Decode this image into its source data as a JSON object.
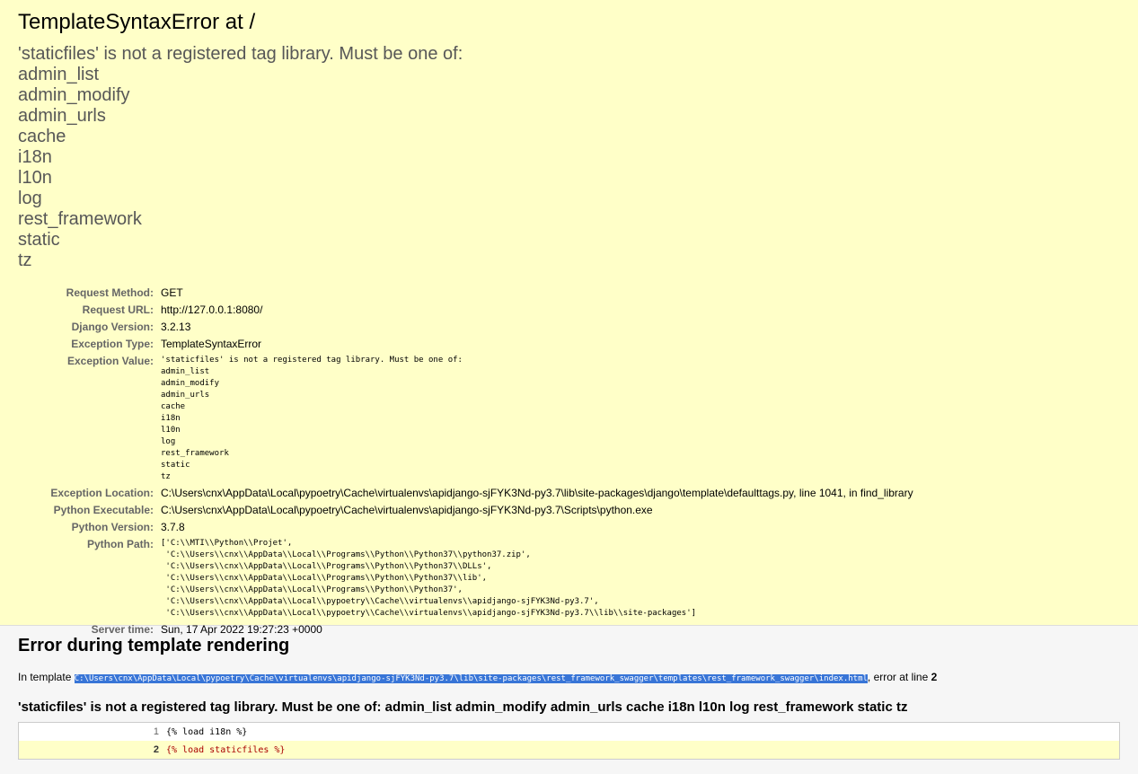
{
  "summary": {
    "title": "TemplateSyntaxError at /",
    "exception_lines": [
      "'staticfiles' is not a registered tag library. Must be one of:",
      "admin_list",
      "admin_modify",
      "admin_urls",
      "cache",
      "i18n",
      "l10n",
      "log",
      "rest_framework",
      "static",
      "tz"
    ],
    "meta": {
      "request_method_label": "Request Method:",
      "request_method": "GET",
      "request_url_label": "Request URL:",
      "request_url": "http://127.0.0.1:8080/",
      "django_version_label": "Django Version:",
      "django_version": "3.2.13",
      "exception_type_label": "Exception Type:",
      "exception_type": "TemplateSyntaxError",
      "exception_value_label": "Exception Value:",
      "exception_value": "'staticfiles' is not a registered tag library. Must be one of:\nadmin_list\nadmin_modify\nadmin_urls\ncache\ni18n\nl10n\nlog\nrest_framework\nstatic\ntz",
      "exception_location_label": "Exception Location:",
      "exception_location": "C:\\Users\\cnx\\AppData\\Local\\pypoetry\\Cache\\virtualenvs\\apidjango-sjFYK3Nd-py3.7\\lib\\site-packages\\django\\template\\defaulttags.py, line 1041, in find_library",
      "python_executable_label": "Python Executable:",
      "python_executable": "C:\\Users\\cnx\\AppData\\Local\\pypoetry\\Cache\\virtualenvs\\apidjango-sjFYK3Nd-py3.7\\Scripts\\python.exe",
      "python_version_label": "Python Version:",
      "python_version": "3.7.8",
      "python_path_label": "Python Path:",
      "python_path": "['C:\\\\MTI\\\\Python\\\\Projet',\n 'C:\\\\Users\\\\cnx\\\\AppData\\\\Local\\\\Programs\\\\Python\\\\Python37\\\\python37.zip',\n 'C:\\\\Users\\\\cnx\\\\AppData\\\\Local\\\\Programs\\\\Python\\\\Python37\\\\DLLs',\n 'C:\\\\Users\\\\cnx\\\\AppData\\\\Local\\\\Programs\\\\Python\\\\Python37\\\\lib',\n 'C:\\\\Users\\\\cnx\\\\AppData\\\\Local\\\\Programs\\\\Python\\\\Python37',\n 'C:\\\\Users\\\\cnx\\\\AppData\\\\Local\\\\pypoetry\\\\Cache\\\\virtualenvs\\\\apidjango-sjFYK3Nd-py3.7',\n 'C:\\\\Users\\\\cnx\\\\AppData\\\\Local\\\\pypoetry\\\\Cache\\\\virtualenvs\\\\apidjango-sjFYK3Nd-py3.7\\\\lib\\\\site-packages']",
      "server_time_label": "Server time:",
      "server_time": "Sun, 17 Apr 2022 19:27:23 +0000"
    }
  },
  "template": {
    "heading": "Error during template rendering",
    "in_template_prefix": "In template ",
    "template_path": "C:\\Users\\cnx\\AppData\\Local\\pypoetry\\Cache\\virtualenvs\\apidjango-sjFYK3Nd-py3.7\\lib\\site-packages\\rest_framework_swagger\\templates\\rest_framework_swagger\\index.html",
    "error_at_line_text": ", error at line ",
    "error_line": "2",
    "error_message": "'staticfiles' is not a registered tag library. Must be one of: admin_list admin_modify admin_urls cache i18n l10n log rest_framework static tz",
    "source_lines": [
      {
        "num": "1",
        "code": "{% load i18n %}"
      },
      {
        "num": "2",
        "code": "{% load staticfiles %}"
      }
    ]
  },
  "colors": {
    "summary_bg": "#ffffc8",
    "template_bg": "#f6f6f6",
    "selection_bg": "#3875d7",
    "error_code": "#aa0000"
  }
}
